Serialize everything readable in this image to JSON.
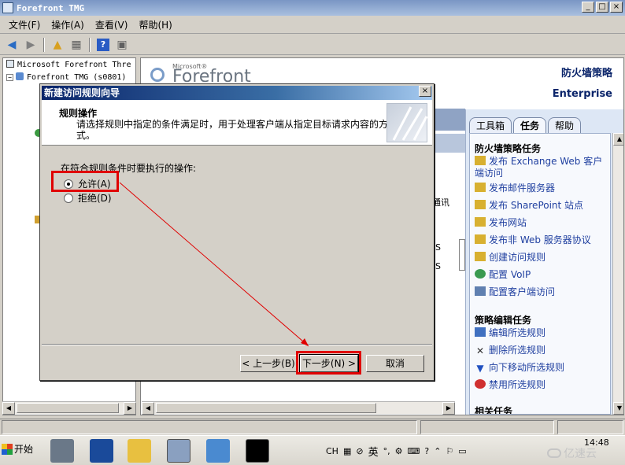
{
  "window": {
    "title": "Forefront TMG"
  },
  "menu": [
    "文件(F)",
    "操作(A)",
    "查看(V)",
    "帮助(H)"
  ],
  "toolbar": [
    "back-icon",
    "forward-icon",
    "up-folder-icon",
    "properties-icon",
    "help-icon",
    "view-icon"
  ],
  "tree": {
    "root": "Microsoft Forefront Thre",
    "node": "Forefront TMG (s0801)"
  },
  "header": {
    "brand_small": "Microsoft®",
    "brand_name": "Forefront",
    "right_title": "防火墙策略",
    "right_subtitle": "Enterprise"
  },
  "center": {
    "col_header": "通讯",
    "row1": "S",
    "row2": "S"
  },
  "task_panel": {
    "tabs": [
      "工具箱",
      "任务",
      "帮助"
    ],
    "sections": [
      {
        "title": "防火墙策略任务",
        "items": [
          "发布 Exchange Web 客户端访问",
          "发布邮件服务器",
          "发布 SharePoint 站点",
          "发布网站",
          "发布非 Web 服务器协议",
          "创建访问规则",
          "配置 VoIP",
          "配置客户端访问"
        ]
      },
      {
        "title": "策略编辑任务",
        "items": [
          "编辑所选规则",
          "删除所选规则",
          "向下移动所选规则",
          "禁用所选规则"
        ]
      },
      {
        "title": "相关任务",
        "items": []
      }
    ]
  },
  "dialog": {
    "title": "新建访问规则向导",
    "header_title": "规则操作",
    "header_desc": "请选择规则中指定的条件满足时，用于处理客户端从指定目标请求内容的方式。",
    "prompt": "在符合规则条件时要执行的操作:",
    "options": [
      {
        "label": "允许(A)",
        "checked": true
      },
      {
        "label": "拒绝(D)",
        "checked": false
      }
    ],
    "buttons": {
      "back": "< 上一步(B)",
      "next": "下一步(N) >",
      "cancel": "取消"
    }
  },
  "taskbar": {
    "start": "开始",
    "lang": "CH",
    "ime": "英",
    "clock": "14:48"
  },
  "watermark": "亿速云",
  "accent": {
    "highlight": "#e00000",
    "link": "#2040a0",
    "titlebar": "#0a246a"
  }
}
